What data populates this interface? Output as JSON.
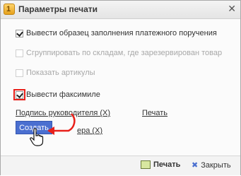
{
  "window": {
    "title": "Параметры печати",
    "close_glyph": "✕"
  },
  "options": [
    {
      "label": "Вывести образец заполнения платежного поручения",
      "checked": true,
      "disabled": false
    },
    {
      "label": "Сгруппировать по складам, где зарезервирован товар",
      "checked": false,
      "disabled": true
    },
    {
      "label": "Показать артикулы",
      "checked": false,
      "disabled": true
    },
    {
      "label": "Вывести факсимиле",
      "checked": true,
      "disabled": false
    }
  ],
  "links": {
    "director_signature": "Подпись руководителя (X)",
    "stamp": "Печать",
    "accountant_signature": "ера (X)"
  },
  "popup": {
    "create_label": "Создать"
  },
  "footer": {
    "print_label": "Печать",
    "close_label": "Закрыть",
    "close_glyph": "✖"
  },
  "colors": {
    "accent": "#4a6fd0",
    "highlight": "#e8201a"
  }
}
